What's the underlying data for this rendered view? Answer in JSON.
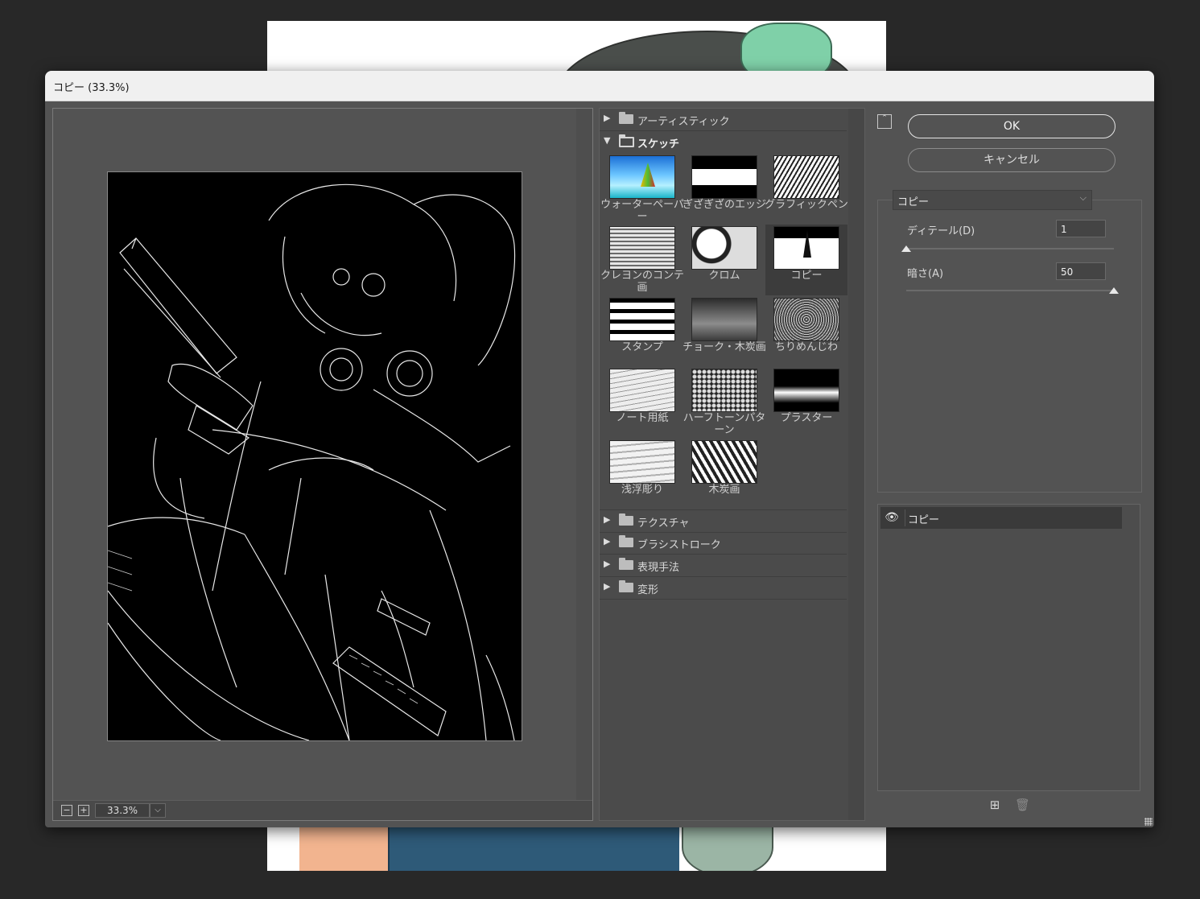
{
  "dialog": {
    "title": "コピー (33.3%)"
  },
  "preview": {
    "zoom": "33.3%",
    "zoom_out_symbol": "−",
    "zoom_in_symbol": "+",
    "zoom_dropdown_symbol": "⌵"
  },
  "browser": {
    "categories_top": [
      {
        "name": "アーティスティック",
        "expanded": false,
        "arrow": "▶"
      },
      {
        "name": "スケッチ",
        "expanded": true,
        "arrow": "▼"
      }
    ],
    "sketch_filters": [
      {
        "label": "ウォーターペーパー",
        "thumb": "water"
      },
      {
        "label": "ぎざぎざのエッジ",
        "thumb": "bw1"
      },
      {
        "label": "グラフィックペン",
        "thumb": "graphic"
      },
      {
        "label": "クレヨンのコンテ画",
        "thumb": "crayon"
      },
      {
        "label": "クロム",
        "thumb": "chrome"
      },
      {
        "label": "コピー",
        "thumb": "copy",
        "selected": true
      },
      {
        "label": "スタンプ",
        "thumb": "stamp"
      },
      {
        "label": "チョーク・木炭画",
        "thumb": "chalk"
      },
      {
        "label": "ちりめんじわ",
        "thumb": "crumple"
      },
      {
        "label": "ノート用紙",
        "thumb": "note"
      },
      {
        "label": "ハーフトーンパターン",
        "thumb": "halftone"
      },
      {
        "label": "プラスター",
        "thumb": "plaster"
      },
      {
        "label": "浅浮彫り",
        "thumb": "relief"
      },
      {
        "label": "木炭画",
        "thumb": "charcoal"
      }
    ],
    "categories_bottom": [
      {
        "name": "テクスチャ",
        "arrow": "▶"
      },
      {
        "name": "ブラシストローク",
        "arrow": "▶"
      },
      {
        "name": "表現手法",
        "arrow": "▶"
      },
      {
        "name": "変形",
        "arrow": "▶"
      }
    ]
  },
  "controls": {
    "collapse_symbol": "⌃",
    "ok_label": "OK",
    "cancel_label": "キャンセル",
    "filter_select": "コピー",
    "filter_select_chevron": "⌵",
    "params": [
      {
        "label": "ディテール(D)",
        "value": "1",
        "slider_fraction": 0.0
      },
      {
        "label": "暗さ(A)",
        "value": "50",
        "slider_fraction": 1.0
      }
    ]
  },
  "layers": {
    "items": [
      {
        "name": "コピー",
        "visible": true,
        "eye_symbol": "👁"
      }
    ],
    "new_layer_symbol": "⊞",
    "delete_layer_symbol": "🗑"
  }
}
